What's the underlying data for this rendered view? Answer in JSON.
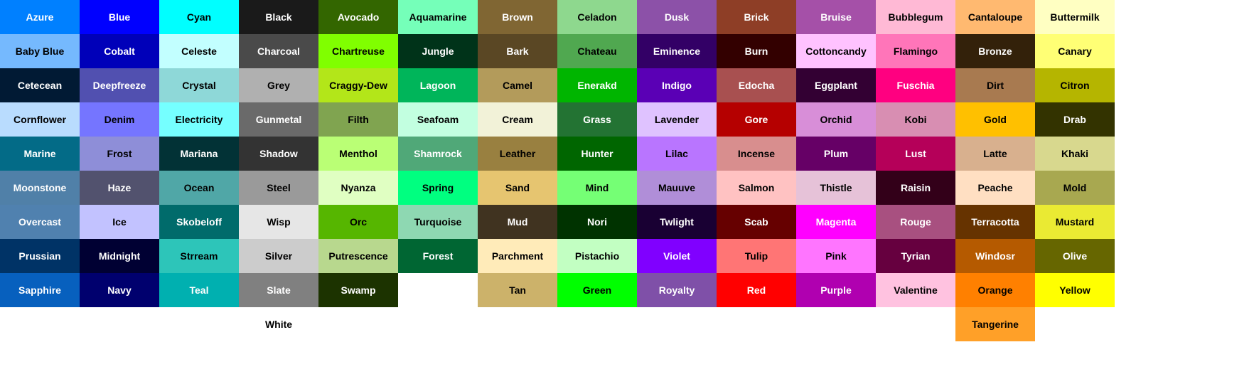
{
  "columns": [
    [
      {
        "name": "Azure",
        "color": "#0080ff",
        "text": "#ffffff"
      },
      {
        "name": "Baby Blue",
        "color": "#75b9fe",
        "text": "#000000"
      },
      {
        "name": "Cetecean",
        "color": "#011a34",
        "text": "#ffffff"
      },
      {
        "name": "Cornflower",
        "color": "#b9dcfe",
        "text": "#000000"
      },
      {
        "name": "Marine",
        "color": "#036b87",
        "text": "#ffffff"
      },
      {
        "name": "Moonstone",
        "color": "#5080a8",
        "text": "#ffffff"
      },
      {
        "name": "Overcast",
        "color": "#5081af",
        "text": "#ffffff"
      },
      {
        "name": "Prussian",
        "color": "#003366",
        "text": "#ffffff"
      },
      {
        "name": "Sapphire",
        "color": "#0760be",
        "text": "#ffffff"
      }
    ],
    [
      {
        "name": "Blue",
        "color": "#0000ff",
        "text": "#ffffff"
      },
      {
        "name": "Cobalt",
        "color": "#0000b9",
        "text": "#ffffff"
      },
      {
        "name": "Deepfreeze",
        "color": "#5150b0",
        "text": "#ffffff"
      },
      {
        "name": "Denim",
        "color": "#7575ff",
        "text": "#000000"
      },
      {
        "name": "Frost",
        "color": "#8e8ed8",
        "text": "#000000"
      },
      {
        "name": "Haze",
        "color": "#52526e",
        "text": "#ffffff"
      },
      {
        "name": "Ice",
        "color": "#c2c2ff",
        "text": "#000000"
      },
      {
        "name": "Midnight",
        "color": "#000033",
        "text": "#ffffff"
      },
      {
        "name": "Navy",
        "color": "#00006e",
        "text": "#ffffff"
      }
    ],
    [
      {
        "name": "Cyan",
        "color": "#00ffff",
        "text": "#000000"
      },
      {
        "name": "Celeste",
        "color": "#c2ffff",
        "text": "#000000"
      },
      {
        "name": "Crystal",
        "color": "#8ed8d8",
        "text": "#000000"
      },
      {
        "name": "Electricity",
        "color": "#75ffff",
        "text": "#000000"
      },
      {
        "name": "Mariana",
        "color": "#023236",
        "text": "#ffffff"
      },
      {
        "name": "Ocean",
        "color": "#50a7a7",
        "text": "#000000"
      },
      {
        "name": "Skobeloff",
        "color": "#006b6b",
        "text": "#ffffff"
      },
      {
        "name": "Strream",
        "color": "#2dc5b9",
        "text": "#000000"
      },
      {
        "name": "Teal",
        "color": "#00b0b0",
        "text": "#ffffff"
      }
    ],
    [
      {
        "name": "Black",
        "color": "#1a1a1a",
        "text": "#ffffff"
      },
      {
        "name": "Charcoal",
        "color": "#4a4a4a",
        "text": "#ffffff"
      },
      {
        "name": "Grey",
        "color": "#b0b0b0",
        "text": "#000000"
      },
      {
        "name": "Gunmetal",
        "color": "#6a6a6a",
        "text": "#ffffff"
      },
      {
        "name": "Shadow",
        "color": "#333333",
        "text": "#ffffff"
      },
      {
        "name": "Steel",
        "color": "#9a9a9a",
        "text": "#000000"
      },
      {
        "name": "Wisp",
        "color": "#e6e6e6",
        "text": "#000000"
      },
      {
        "name": "Silver",
        "color": "#cccccc",
        "text": "#000000"
      },
      {
        "name": "Slate",
        "color": "#808080",
        "text": "#ffffff"
      },
      {
        "name": "White",
        "color": "#ffffff",
        "text": "#000000"
      }
    ],
    [
      {
        "name": "Avocado",
        "color": "#336600",
        "text": "#ffffff"
      },
      {
        "name": "Chartreuse",
        "color": "#80ff00",
        "text": "#000000"
      },
      {
        "name": "Craggy-Dew",
        "color": "#b3e619",
        "text": "#000000"
      },
      {
        "name": "Filth",
        "color": "#80a450",
        "text": "#000000"
      },
      {
        "name": "Menthol",
        "color": "#baff75",
        "text": "#000000"
      },
      {
        "name": "Nyanza",
        "color": "#e0ffc2",
        "text": "#000000"
      },
      {
        "name": "Orc",
        "color": "#56b600",
        "text": "#000000"
      },
      {
        "name": "Putrescence",
        "color": "#b8d88e",
        "text": "#000000"
      },
      {
        "name": "Swamp",
        "color": "#1c3300",
        "text": "#ffffff"
      }
    ],
    [
      {
        "name": "Aquamarine",
        "color": "#75ffb9",
        "text": "#000000"
      },
      {
        "name": "Jungle",
        "color": "#003319",
        "text": "#ffffff"
      },
      {
        "name": "Lagoon",
        "color": "#00b55a",
        "text": "#ffffff"
      },
      {
        "name": "Seafoam",
        "color": "#c2ffe0",
        "text": "#000000"
      },
      {
        "name": "Shamrock",
        "color": "#50a878",
        "text": "#ffffff"
      },
      {
        "name": "Spring",
        "color": "#00ff80",
        "text": "#000000"
      },
      {
        "name": "Turquoise",
        "color": "#8ed8b2",
        "text": "#000000"
      },
      {
        "name": "Forest",
        "color": "#006633",
        "text": "#ffffff"
      }
    ],
    [
      {
        "name": "Brown",
        "color": "#806633",
        "text": "#ffffff"
      },
      {
        "name": "Bark",
        "color": "#5a4724",
        "text": "#ffffff"
      },
      {
        "name": "Camel",
        "color": "#b39b5b",
        "text": "#000000"
      },
      {
        "name": "Cream",
        "color": "#f2f2d8",
        "text": "#000000"
      },
      {
        "name": "Leather",
        "color": "#998040",
        "text": "#000000"
      },
      {
        "name": "Sand",
        "color": "#e6c570",
        "text": "#000000"
      },
      {
        "name": "Mud",
        "color": "#403320",
        "text": "#ffffff"
      },
      {
        "name": "Parchment",
        "color": "#ffebb9",
        "text": "#000000"
      },
      {
        "name": "Tan",
        "color": "#ccb26a",
        "text": "#000000"
      }
    ],
    [
      {
        "name": "Celadon",
        "color": "#8ed88e",
        "text": "#000000"
      },
      {
        "name": "Chateau",
        "color": "#50a850",
        "text": "#000000"
      },
      {
        "name": "Enerakd",
        "color": "#00b500",
        "text": "#ffffff"
      },
      {
        "name": "Grass",
        "color": "#237333",
        "text": "#ffffff"
      },
      {
        "name": "Hunter",
        "color": "#006600",
        "text": "#ffffff"
      },
      {
        "name": "Mind",
        "color": "#75ff75",
        "text": "#000000"
      },
      {
        "name": "Nori",
        "color": "#003300",
        "text": "#ffffff"
      },
      {
        "name": "Pistachio",
        "color": "#c2ffc2",
        "text": "#000000"
      },
      {
        "name": "Green",
        "color": "#00ff00",
        "text": "#000000"
      }
    ],
    [
      {
        "name": "Dusk",
        "color": "#8c51a8",
        "text": "#ffffff"
      },
      {
        "name": "Eminence",
        "color": "#330066",
        "text": "#ffffff"
      },
      {
        "name": "Indigo",
        "color": "#5a00b5",
        "text": "#ffffff"
      },
      {
        "name": "Lavender",
        "color": "#dfc2ff",
        "text": "#000000"
      },
      {
        "name": "Lilac",
        "color": "#b975ff",
        "text": "#000000"
      },
      {
        "name": "Mauuve",
        "color": "#b08ed8",
        "text": "#000000"
      },
      {
        "name": "Twlight",
        "color": "#190033",
        "text": "#ffffff"
      },
      {
        "name": "Violet",
        "color": "#8000ff",
        "text": "#ffffff"
      },
      {
        "name": "Royalty",
        "color": "#7f50a8",
        "text": "#ffffff"
      }
    ],
    [
      {
        "name": "Brick",
        "color": "#8e3e26",
        "text": "#ffffff"
      },
      {
        "name": "Burn",
        "color": "#330000",
        "text": "#ffffff"
      },
      {
        "name": "Edocha",
        "color": "#a85050",
        "text": "#ffffff"
      },
      {
        "name": "Gore",
        "color": "#b50000",
        "text": "#ffffff"
      },
      {
        "name": "Incense",
        "color": "#d88e8e",
        "text": "#000000"
      },
      {
        "name": "Salmon",
        "color": "#ffc2c2",
        "text": "#000000"
      },
      {
        "name": "Scab",
        "color": "#660000",
        "text": "#ffffff"
      },
      {
        "name": "Tulip",
        "color": "#ff7575",
        "text": "#000000"
      },
      {
        "name": "Red",
        "color": "#ff0000",
        "text": "#ffffff"
      }
    ],
    [
      {
        "name": "Bruise",
        "color": "#a550a8",
        "text": "#ffffff"
      },
      {
        "name": "Cottoncandy",
        "color": "#ffc2ff",
        "text": "#000000"
      },
      {
        "name": "Eggplant",
        "color": "#330033",
        "text": "#ffffff"
      },
      {
        "name": "Orchid",
        "color": "#d88ed8",
        "text": "#000000"
      },
      {
        "name": "Plum",
        "color": "#660066",
        "text": "#ffffff"
      },
      {
        "name": "Thistle",
        "color": "#e6c2d8",
        "text": "#000000"
      },
      {
        "name": "Magenta",
        "color": "#ff00ff",
        "text": "#ffffff"
      },
      {
        "name": "Pink",
        "color": "#ff75ff",
        "text": "#000000"
      },
      {
        "name": "Purple",
        "color": "#b000b0",
        "text": "#ffffff"
      }
    ],
    [
      {
        "name": "Bubblegum",
        "color": "#ffb9d5",
        "text": "#000000"
      },
      {
        "name": "Flamingo",
        "color": "#ff75b9",
        "text": "#000000"
      },
      {
        "name": "Fuschia",
        "color": "#ff0080",
        "text": "#ffffff"
      },
      {
        "name": "Kobi",
        "color": "#d88eb2",
        "text": "#000000"
      },
      {
        "name": "Lust",
        "color": "#b50059",
        "text": "#ffffff"
      },
      {
        "name": "Raisin",
        "color": "#330019",
        "text": "#ffffff"
      },
      {
        "name": "Rouge",
        "color": "#a85080",
        "text": "#ffffff"
      },
      {
        "name": "Tyrian",
        "color": "#66003f",
        "text": "#ffffff"
      },
      {
        "name": "Valentine",
        "color": "#ffc2e0",
        "text": "#000000"
      }
    ],
    [
      {
        "name": "Cantaloupe",
        "color": "#ffb970",
        "text": "#000000"
      },
      {
        "name": "Bronze",
        "color": "#33210a",
        "text": "#ffffff"
      },
      {
        "name": "Dirt",
        "color": "#a87a50",
        "text": "#000000"
      },
      {
        "name": "Gold",
        "color": "#ffc000",
        "text": "#000000"
      },
      {
        "name": "Latte",
        "color": "#d8b08e",
        "text": "#000000"
      },
      {
        "name": "Peache",
        "color": "#ffdfc2",
        "text": "#000000"
      },
      {
        "name": "Terracotta",
        "color": "#663300",
        "text": "#ffffff"
      },
      {
        "name": "Windosr",
        "color": "#b55a00",
        "text": "#ffffff"
      },
      {
        "name": "Orange",
        "color": "#ff8000",
        "text": "#000000"
      },
      {
        "name": "Tangerine",
        "color": "#ffa028",
        "text": "#000000"
      }
    ],
    [
      {
        "name": "Buttermilk",
        "color": "#ffffc2",
        "text": "#000000"
      },
      {
        "name": "Canary",
        "color": "#ffff75",
        "text": "#000000"
      },
      {
        "name": "Citron",
        "color": "#b5b500",
        "text": "#000000"
      },
      {
        "name": "Drab",
        "color": "#333300",
        "text": "#ffffff"
      },
      {
        "name": "Khaki",
        "color": "#d8d88e",
        "text": "#000000"
      },
      {
        "name": "Mold",
        "color": "#a8a850",
        "text": "#000000"
      },
      {
        "name": "Mustard",
        "color": "#eaea33",
        "text": "#000000"
      },
      {
        "name": "Olive",
        "color": "#666600",
        "text": "#ffffff"
      },
      {
        "name": "Yellow",
        "color": "#ffff00",
        "text": "#000000"
      }
    ]
  ]
}
